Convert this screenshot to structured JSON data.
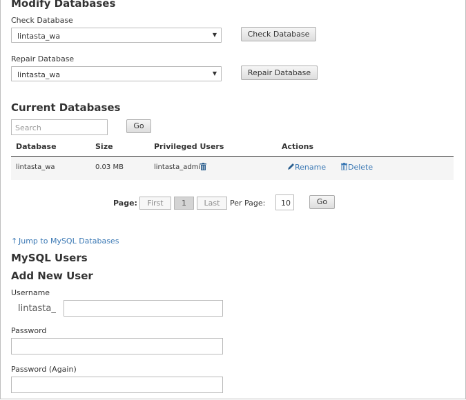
{
  "modify": {
    "title": "Modify Databases",
    "check_label": "Check Database",
    "check_value": "lintasta_wa",
    "check_button": "Check Database",
    "repair_label": "Repair Database",
    "repair_value": "lintasta_wa",
    "repair_button": "Repair Database"
  },
  "current": {
    "title": "Current Databases",
    "search_placeholder": "Search",
    "go_label": "Go",
    "columns": [
      "Database",
      "Size",
      "Privileged Users",
      "Actions"
    ],
    "rows": [
      {
        "database": "lintasta_wa",
        "size": "0.03 MB",
        "user": "lintasta_admin",
        "rename": "Rename",
        "delete": "Delete"
      }
    ]
  },
  "pagination": {
    "page_label": "Page:",
    "first": "First",
    "current": "1",
    "last": "Last",
    "per_page_label": "Per Page:",
    "per_page_value": "10",
    "go_label": "Go"
  },
  "jump_link": "Jump to MySQL Databases",
  "users": {
    "title": "MySQL Users",
    "add_title": "Add New User",
    "username_label": "Username",
    "username_prefix": "lintasta_",
    "password_label": "Password",
    "password_again_label": "Password (Again)"
  },
  "colors": {
    "link": "#3a78b4",
    "border": "#bdbdbd"
  }
}
